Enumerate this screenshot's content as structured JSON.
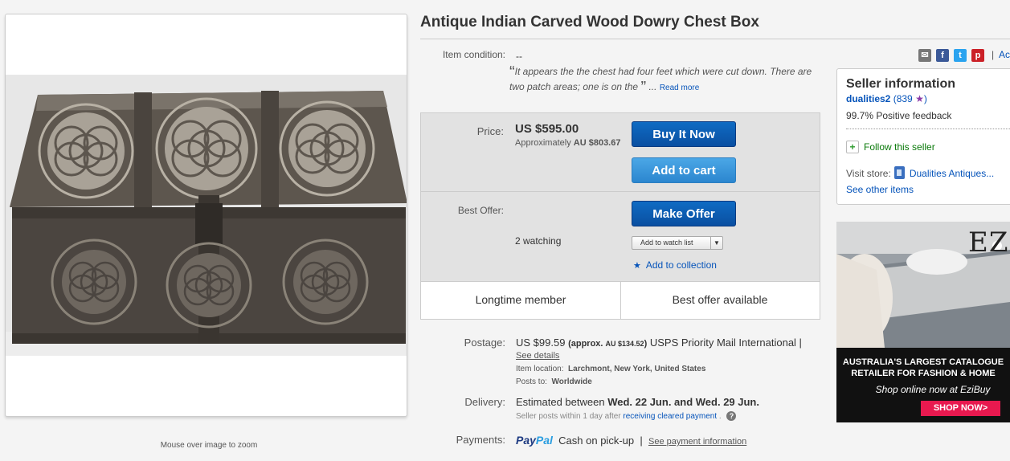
{
  "item": {
    "title": "Antique Indian Carved Wood Dowry Chest Box",
    "zoom_hint": "Mouse over image to zoom",
    "condition_label": "Item condition:",
    "condition_value": "--",
    "condition_desc": "It appears the the chest had four feet which were cut down. There are two patch areas; one is on the",
    "condition_ellipsis": "...",
    "read_more": "Read more"
  },
  "buybox": {
    "price_label": "Price:",
    "price": "US $595.00",
    "approx_label": "Approximately",
    "approx_value": "AU $803.67",
    "buy_now": "Buy It Now",
    "add_to_cart": "Add to cart",
    "best_offer_label": "Best Offer:",
    "make_offer": "Make Offer",
    "watching": "2 watching",
    "watch_list": "Add to watch list",
    "add_collection": "Add to collection",
    "badge_left": "Longtime member",
    "badge_right": "Best offer available"
  },
  "shipping": {
    "postage_label": "Postage:",
    "postage_price": "US $99.59",
    "postage_approx_open": "(approx.",
    "postage_approx_value": "AU $134.52",
    "postage_approx_close": ")",
    "postage_service": "USPS Priority Mail International |",
    "see_details": "See details",
    "location_label": "Item location:",
    "location_value": "Larchmont, New York, United States",
    "posts_label": "Posts to:",
    "posts_value": "Worldwide",
    "delivery_label": "Delivery:",
    "delivery_prefix": "Estimated between",
    "delivery_dates": "Wed. 22 Jun. and Wed. 29 Jun.",
    "seller_posts": "Seller posts within 1 day after",
    "receiving_link": "receiving cleared payment",
    "period": ".",
    "help": "?",
    "payments_label": "Payments:",
    "paypal_a": "Pay",
    "paypal_b": "Pal",
    "cash": "Cash on pick-up",
    "pipe": "|",
    "payment_info": "See payment information"
  },
  "share": {
    "separator": "|",
    "more": "Ac"
  },
  "seller": {
    "title": "Seller information",
    "name": "dualities2",
    "feedback_score_open": "(839",
    "feedback_score_close": ")",
    "positive": "99.7% Positive feedback",
    "follow": "Follow this seller",
    "visit_label": "Visit store:",
    "store_name": "Dualities Antiques...",
    "other_items": "See other items"
  },
  "ad": {
    "brand": "EZI",
    "headline_1": "AUSTRALIA'S LARGEST CATALOGUE",
    "headline_2": "RETAILER FOR FASHION & HOME",
    "sub": "Shop online now at EziBuy",
    "cta": "SHOP NOW>"
  }
}
